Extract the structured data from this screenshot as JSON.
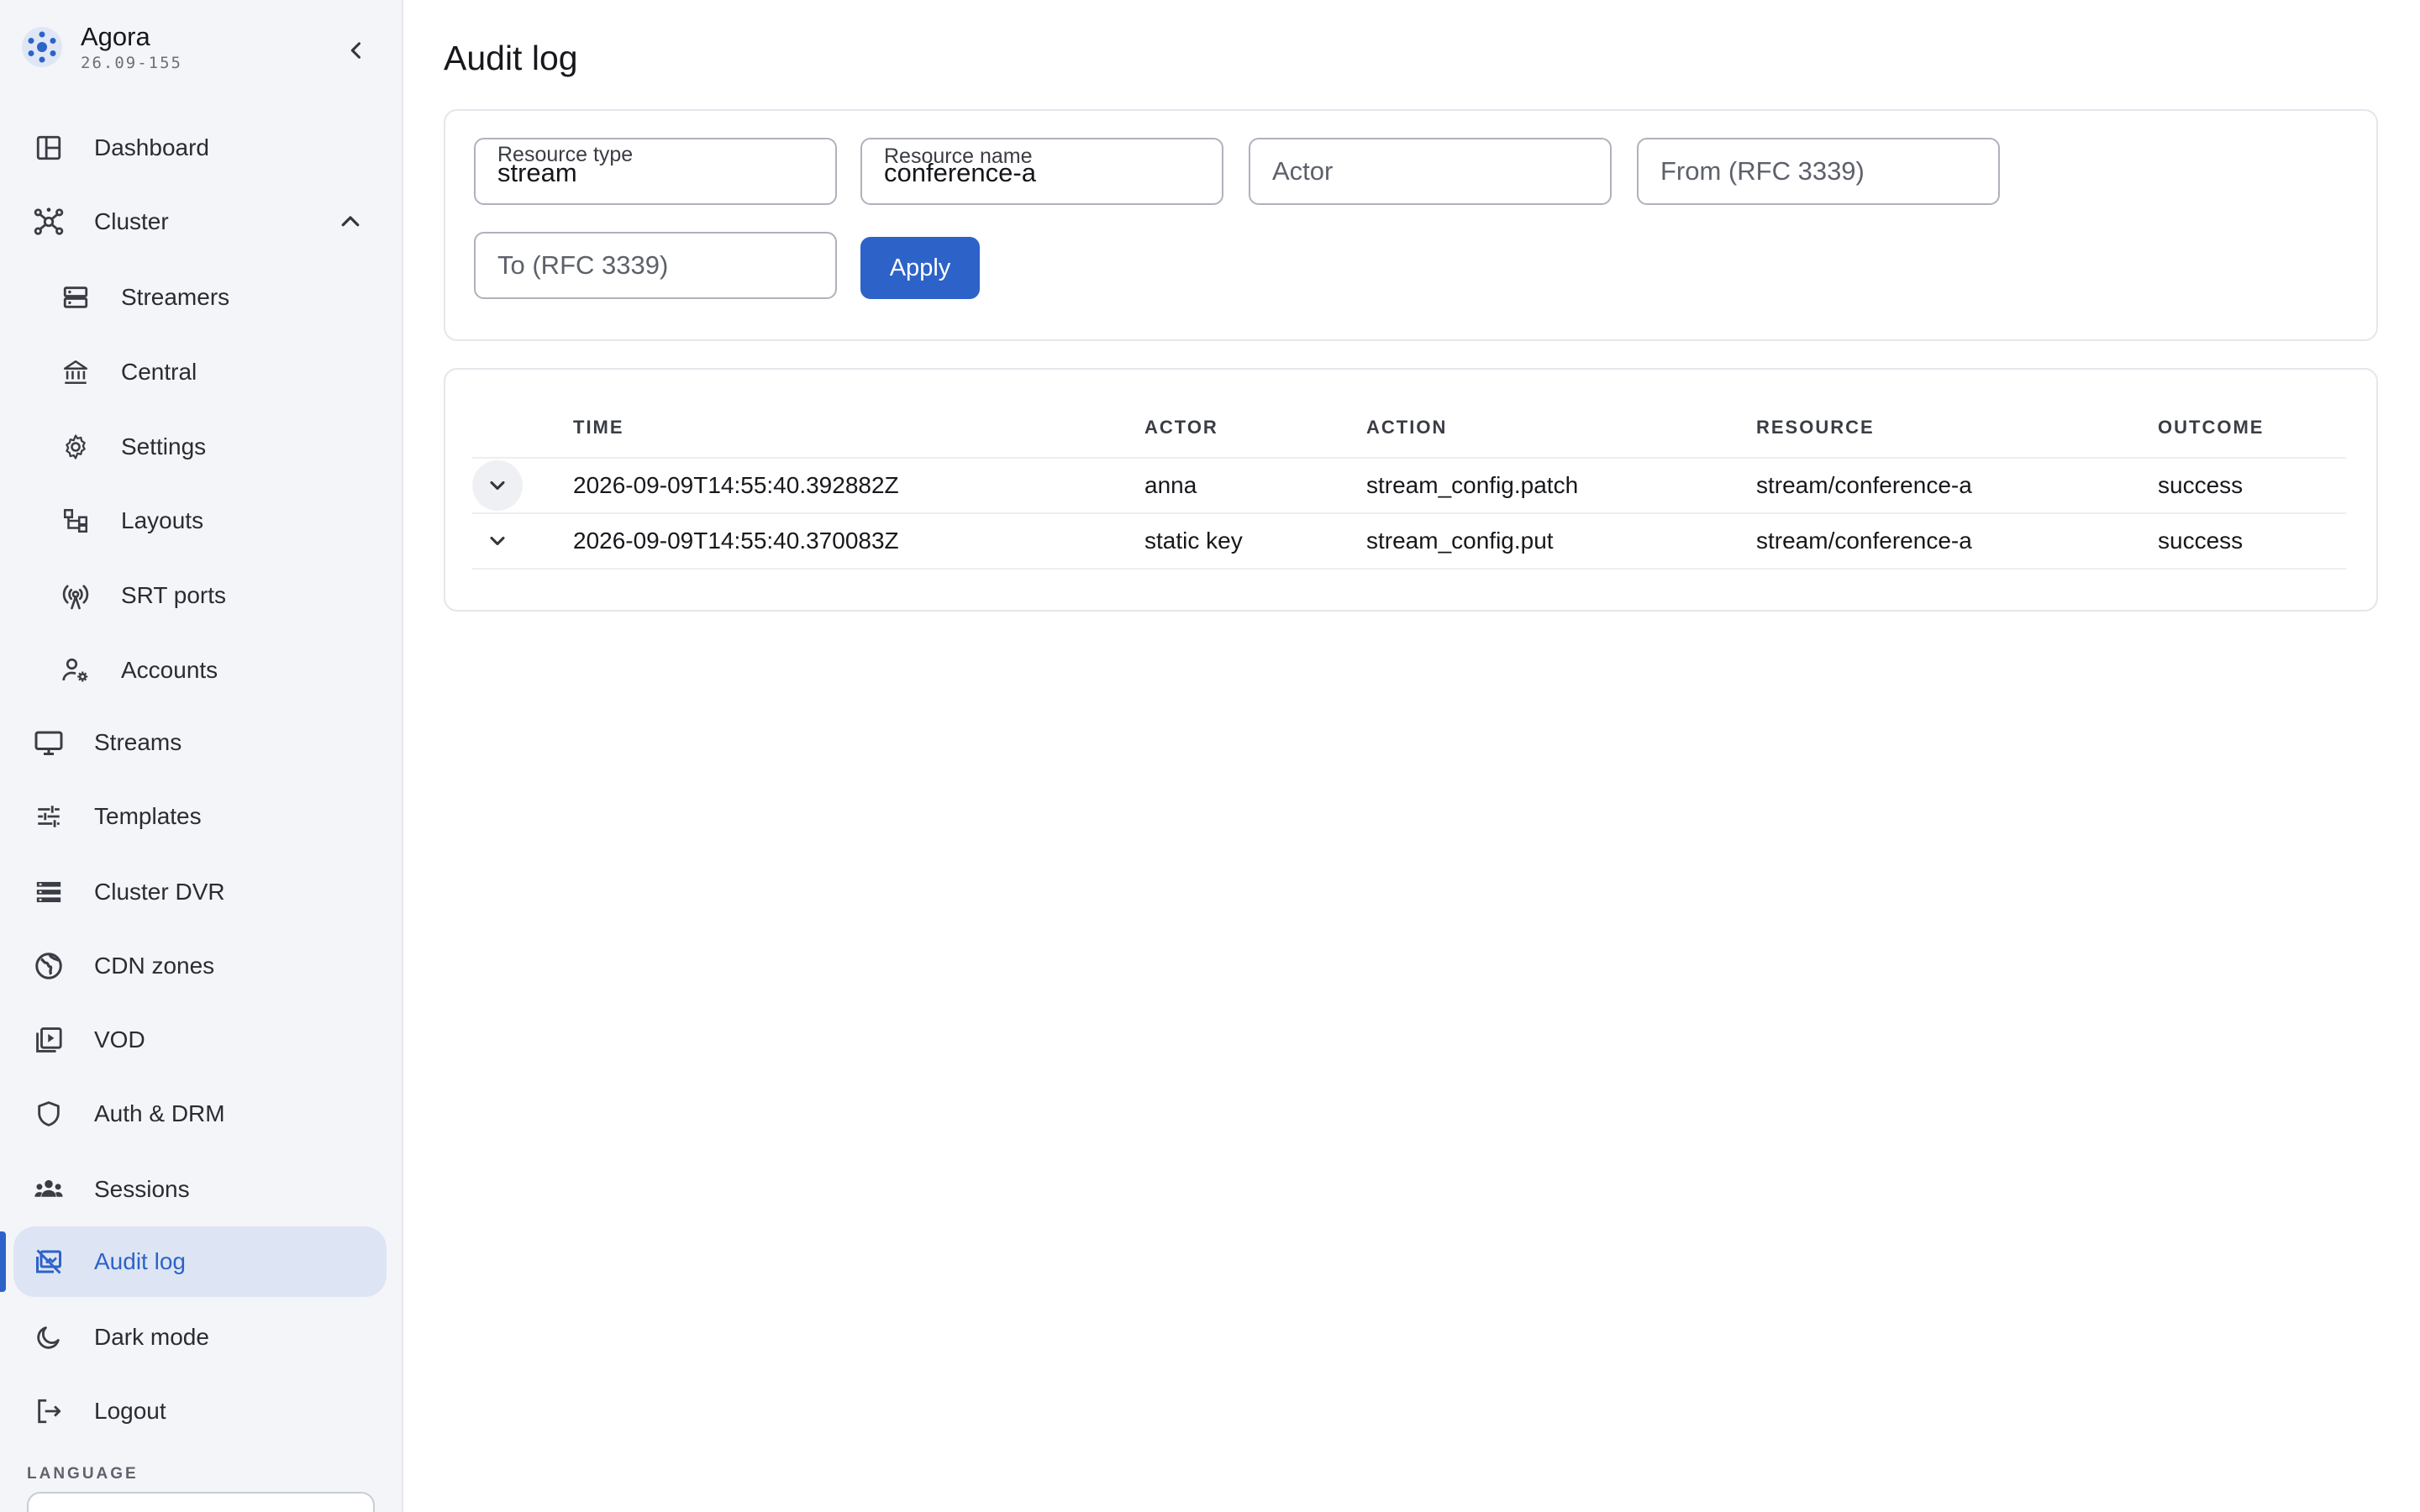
{
  "brand": {
    "name": "Agora",
    "version": "26.09-155"
  },
  "sidebar": {
    "items": [
      {
        "label": "Dashboard",
        "icon": "dashboard-icon"
      },
      {
        "label": "Cluster",
        "icon": "cluster-icon"
      },
      {
        "label": "Streamers",
        "icon": "server-icon"
      },
      {
        "label": "Central",
        "icon": "bank-icon"
      },
      {
        "label": "Settings",
        "icon": "gear-icon"
      },
      {
        "label": "Layouts",
        "icon": "layouts-icon"
      },
      {
        "label": "SRT ports",
        "icon": "antenna-icon"
      },
      {
        "label": "Accounts",
        "icon": "user-gear-icon"
      },
      {
        "label": "Streams",
        "icon": "monitor-icon"
      },
      {
        "label": "Templates",
        "icon": "sliders-icon"
      },
      {
        "label": "Cluster DVR",
        "icon": "storage-icon"
      },
      {
        "label": "CDN zones",
        "icon": "globe-icon"
      },
      {
        "label": "VOD",
        "icon": "video-library-icon"
      },
      {
        "label": "Auth & DRM",
        "icon": "shield-icon"
      },
      {
        "label": "Sessions",
        "icon": "group-icon"
      },
      {
        "label": "Audit log",
        "icon": "audit-icon"
      },
      {
        "label": "Dark mode",
        "icon": "moon-icon"
      },
      {
        "label": "Logout",
        "icon": "logout-icon"
      }
    ],
    "active": "Audit log",
    "language_label": "LANGUAGE"
  },
  "page": {
    "title": "Audit log"
  },
  "filters": {
    "resource_type": {
      "label": "Resource type",
      "value": "stream"
    },
    "resource_name": {
      "label": "Resource name",
      "value": "conference-a"
    },
    "actor": {
      "placeholder": "Actor"
    },
    "from": {
      "placeholder": "From (RFC 3339)"
    },
    "to": {
      "placeholder": "To (RFC 3339)"
    },
    "apply_label": "Apply"
  },
  "table": {
    "columns": [
      "TIME",
      "ACTOR",
      "ACTION",
      "RESOURCE",
      "OUTCOME"
    ],
    "rows": [
      {
        "time": "2026-09-09T14:55:40.392882Z",
        "actor": "anna",
        "action": "stream_config.patch",
        "resource": "stream/conference-a",
        "outcome": "success"
      },
      {
        "time": "2026-09-09T14:55:40.370083Z",
        "actor": "static key",
        "action": "stream_config.put",
        "resource": "stream/conference-a",
        "outcome": "success"
      }
    ]
  },
  "colors": {
    "accent": "#2d63c8",
    "sidebar_bg": "#f4f5f8",
    "active_bg": "#dde5f4"
  }
}
